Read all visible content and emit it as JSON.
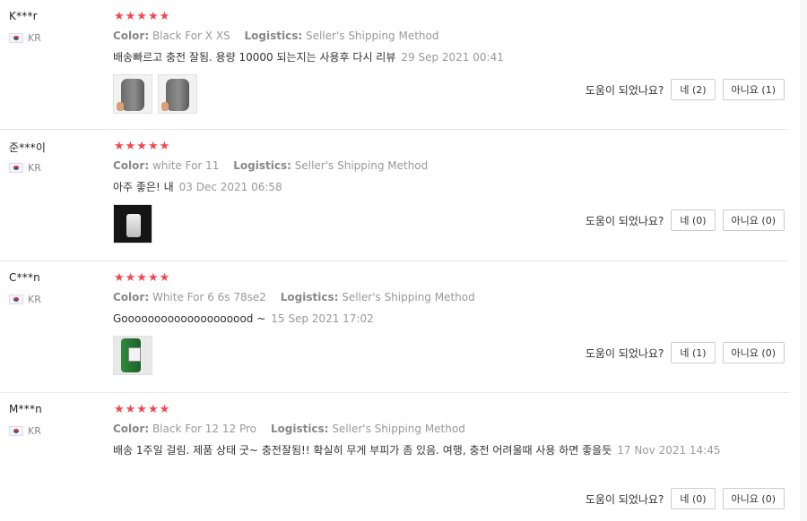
{
  "labels": {
    "color": "Color:",
    "logistics": "Logistics:",
    "helpful_question": "도움이 되었나요?"
  },
  "reviews": [
    {
      "user": "K***r",
      "country": "KR",
      "stars": "★★★★★",
      "color_value": "Black For X XS",
      "logistics_value": "Seller's Shipping Method",
      "text": "배송빠르고 충전 잘됨. 용량 10000 되는지는 사용후 다시 리뷰",
      "date": "29 Sep 2021 00:41",
      "yes": "네 (2)",
      "no": "아니요 (1)"
    },
    {
      "user": "준***이",
      "country": "KR",
      "stars": "★★★★★",
      "color_value": "white For 11",
      "logistics_value": "Seller's Shipping Method",
      "text": "아주 좋은! 내",
      "date": "03 Dec 2021 06:58",
      "yes": "네 (0)",
      "no": "아니요 (0)"
    },
    {
      "user": "C***n",
      "country": "KR",
      "stars": "★★★★★",
      "color_value": "White For 6 6s 78se2",
      "logistics_value": "Seller's Shipping Method",
      "text": "Goooooooooooooooooood ~",
      "date": "15 Sep 2021 17:02",
      "yes": "네 (1)",
      "no": "아니요 (0)"
    },
    {
      "user": "M***n",
      "country": "KR",
      "stars": "★★★★★",
      "color_value": "Black For 12 12 Pro",
      "logistics_value": "Seller's Shipping Method",
      "text": "배송 1주일 걸림. 제품 상태 굿~ 충전잘됨!! 확실히 무게 부피가 좀 있음. 여행, 충전 어려울때 사용 하면 좋을듯",
      "date": "17 Nov 2021 14:45",
      "yes": "네 (0)",
      "no": "아니요 (0)"
    }
  ]
}
